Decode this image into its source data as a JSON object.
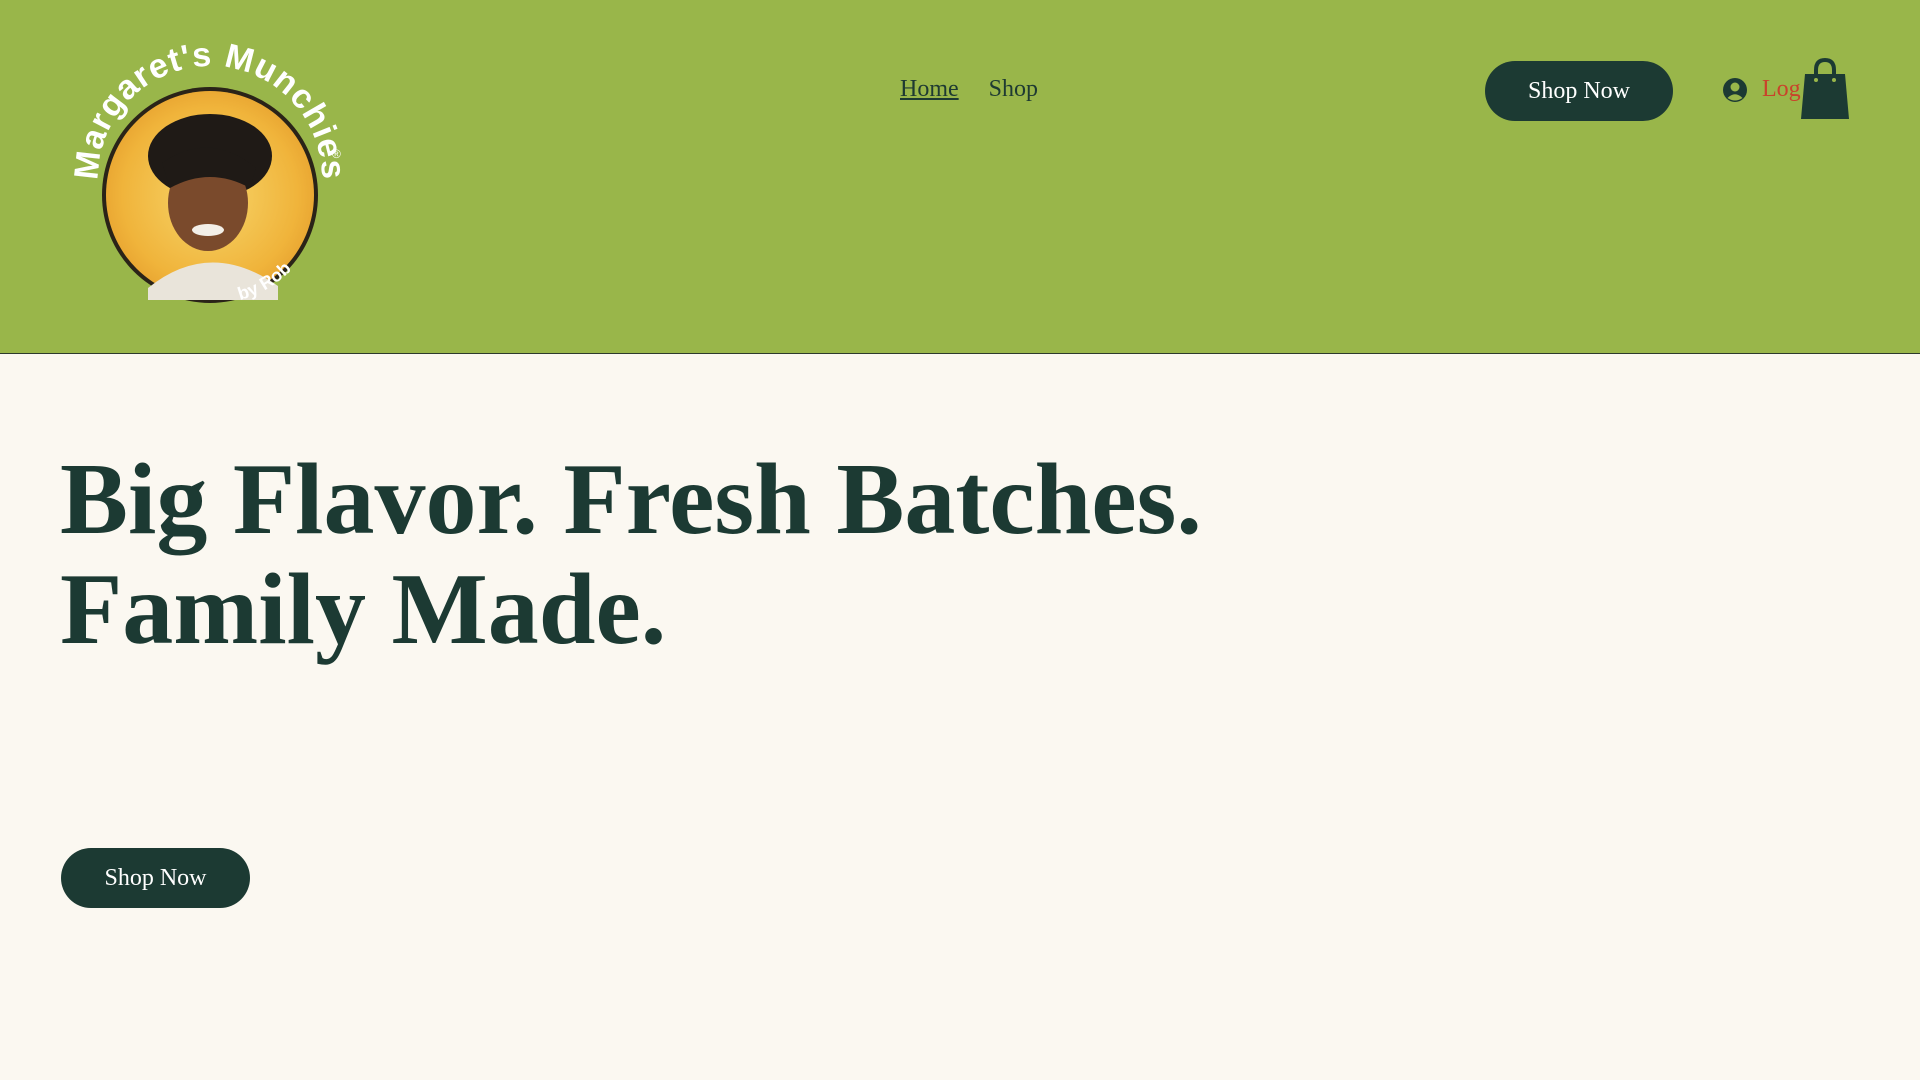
{
  "brand": {
    "logo_text": "Margaret's Munchies",
    "logo_registered": "®",
    "logo_byline": "by Rob"
  },
  "nav": {
    "items": [
      {
        "label": "Home",
        "active": true
      },
      {
        "label": "Shop",
        "active": false
      }
    ]
  },
  "header": {
    "cta_label": "Shop Now",
    "login_label": "Log In"
  },
  "hero": {
    "line1": "Big Flavor. Fresh Batches.",
    "line2": "Family Made.",
    "cta_label": "Shop Now"
  },
  "icons": {
    "user": "user-circle-icon",
    "cart": "shopping-bag-icon"
  },
  "colors": {
    "header_bg": "#99b64a",
    "page_bg": "#fbf8f1",
    "primary": "#1c3a33",
    "login_accent": "#c9432b"
  }
}
